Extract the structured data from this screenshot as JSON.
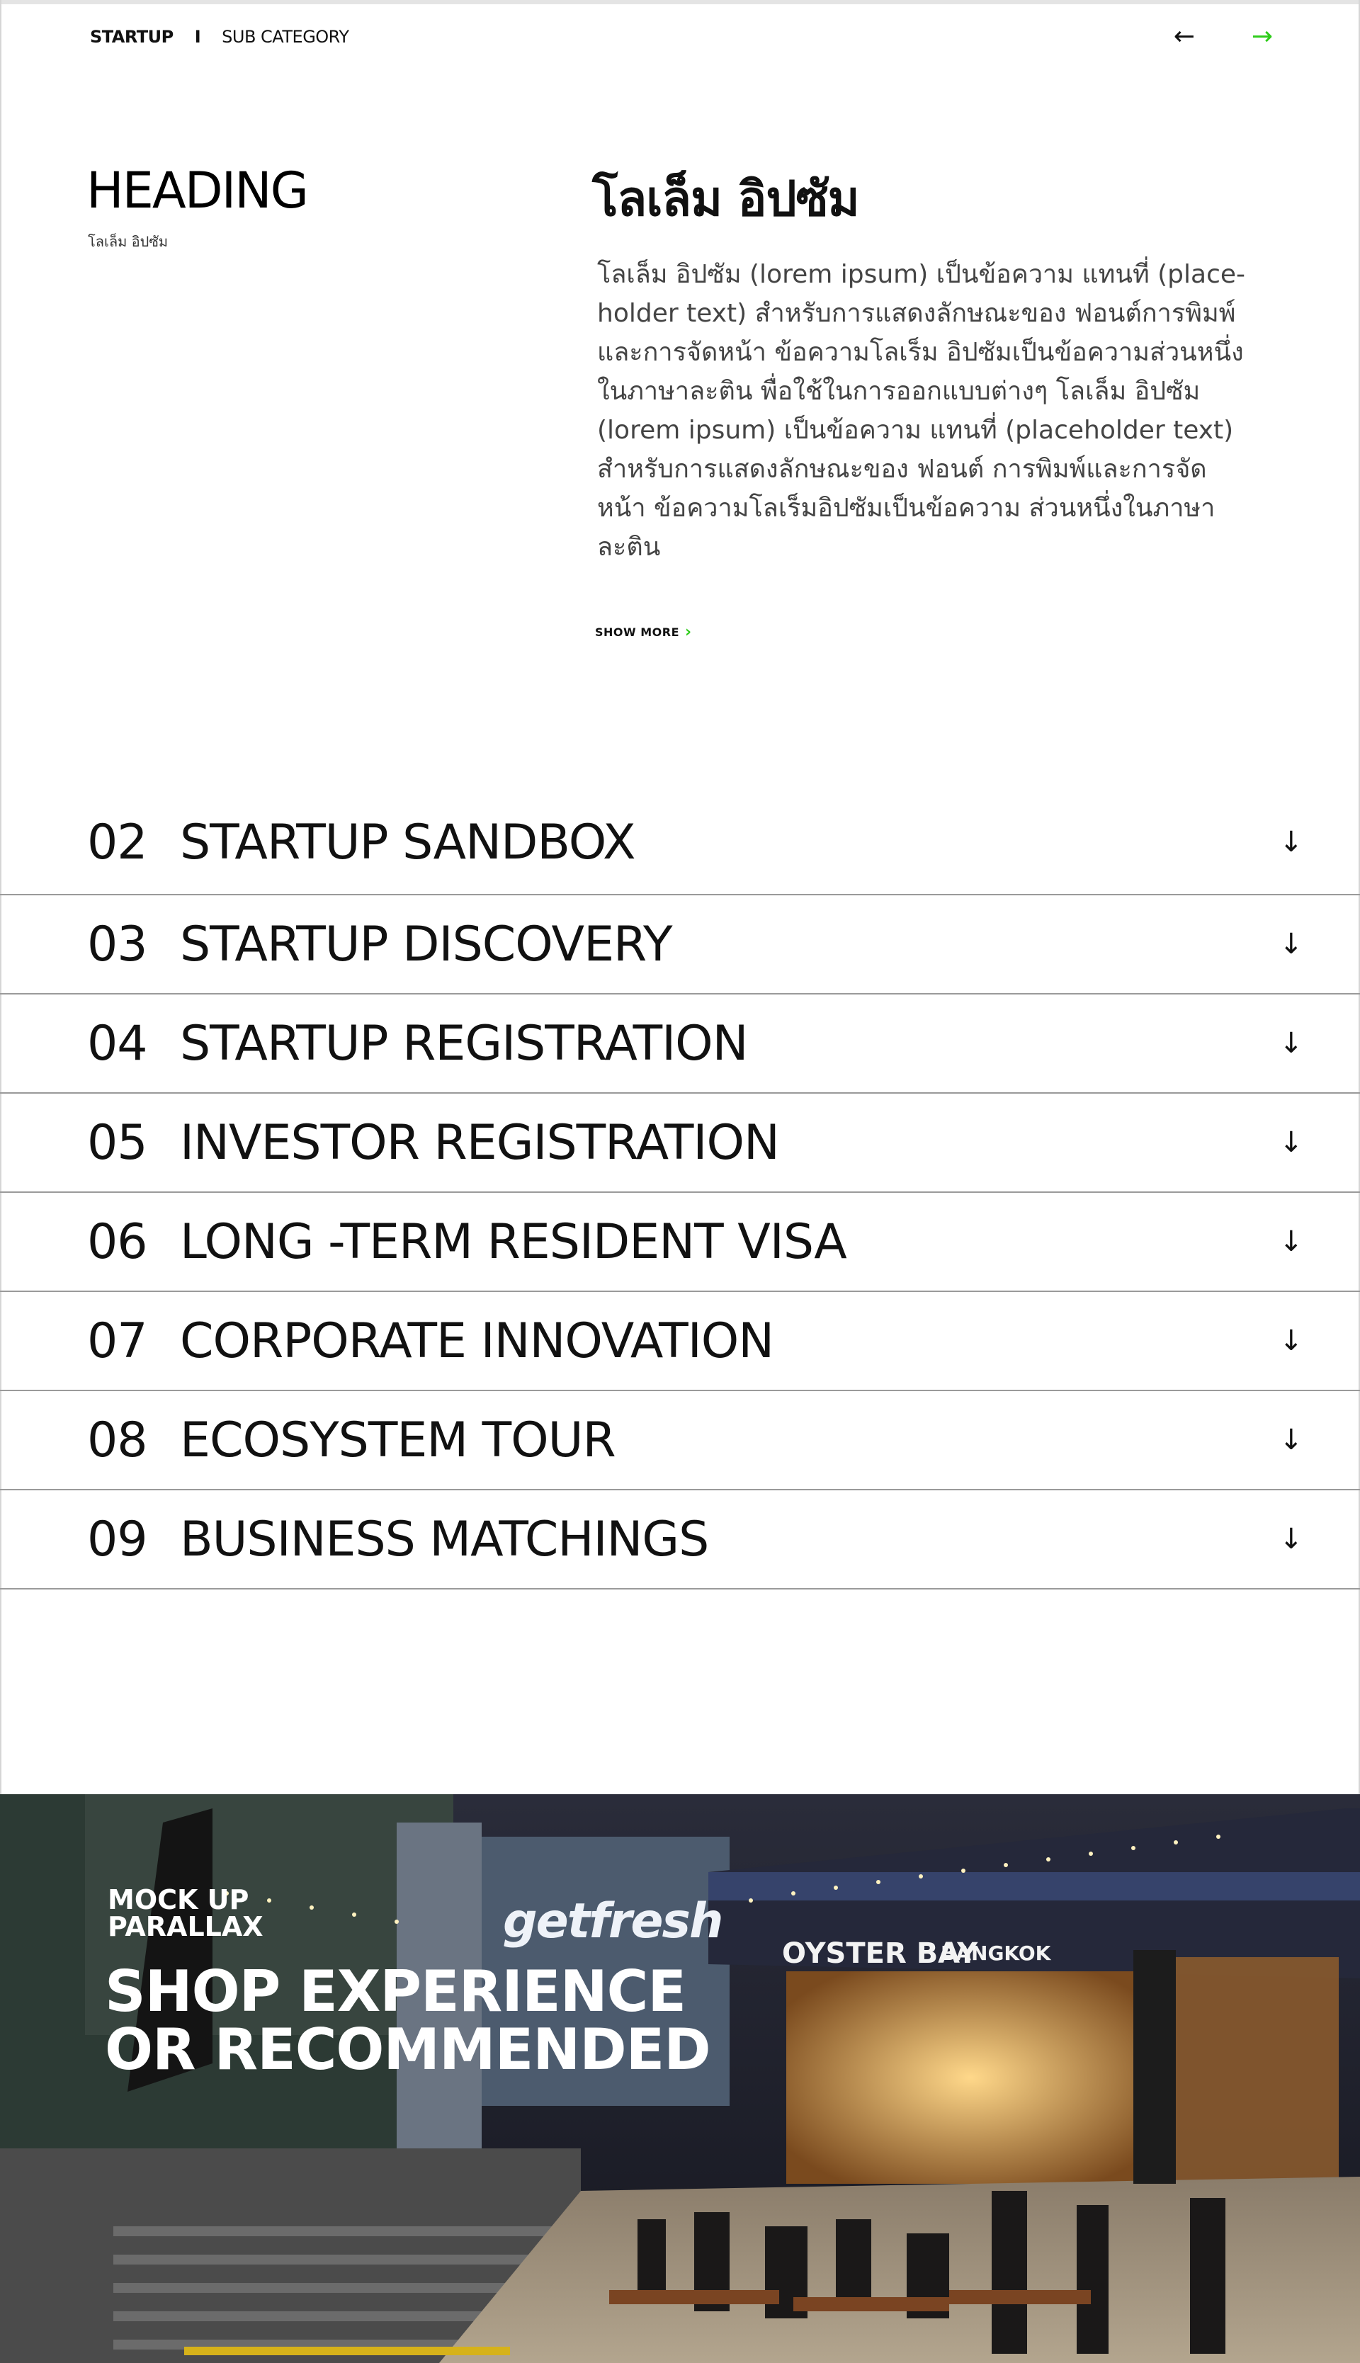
{
  "breadcrumb": {
    "main": "STARTUP",
    "separator": "I",
    "sub": "SUB CATEGORY"
  },
  "nav": {
    "prev_icon": "arrow-left-icon",
    "prev_glyph": "←",
    "next_icon": "arrow-right-icon",
    "next_glyph": "→",
    "accent_color": "#2ecc1a"
  },
  "intro": {
    "heading": "HEADING",
    "heading_sub": "โลเล็ม อิปซัม",
    "title": "โลเล็ม อิปซัม",
    "body_lines": [
      "โลเล็ม อิปซัม (lorem ipsum) เป็นข้อความ แทนที่ (place-",
      "holder text) สำหรับการแสดงลักษณะของ ฟอนต์การพิมพ์",
      "และการจัดหน้า ข้อความโลเร็ม อิปซัมเป็นข้อความส่วนหนึ่ง",
      "ในภาษาละติน  พื่อใช้ในการออกแบบต่างๆ โลเล็ม อิปซัม",
      "(lorem ipsum) เป็นข้อความ แทนที่ (placeholder text)",
      "สำหรับการแสดงลักษณะของ ฟอนต์ การพิมพ์และการจัด",
      "หน้า ข้อความโลเร็มอิปซัมเป็นข้อความ ส่วนหนึ่งในภาษา",
      "ละติน"
    ],
    "show_more": "SHOW MORE",
    "show_more_icon": "chevron-right-icon",
    "show_more_glyph": "›"
  },
  "accordion": {
    "arrow_icon": "arrow-down-icon",
    "arrow_glyph": "↓",
    "items": [
      {
        "num": "02",
        "title": "STARTUP SANDBOX"
      },
      {
        "num": "03",
        "title": "STARTUP DISCOVERY"
      },
      {
        "num": "04",
        "title": "STARTUP REGISTRATION"
      },
      {
        "num": "05",
        "title": "INVESTOR REGISTRATION"
      },
      {
        "num": "06",
        "title": "LONG -TERM RESIDENT VISA"
      },
      {
        "num": "07",
        "title": "CORPORATE INNOVATION"
      },
      {
        "num": "08",
        "title": "ECOSYSTEM  TOUR"
      },
      {
        "num": "09",
        "title": "BUSINESS  MATCHINGS"
      }
    ]
  },
  "hero": {
    "kicker_line1": "MOCK UP",
    "kicker_line2": "PARALLAX",
    "title_line1": "SHOP EXPERIENCE",
    "title_line2": "OR RECOMMENDED",
    "sign_getfresh": "getfresh",
    "sign_oyster": "OYSTER BAY",
    "sign_bangkok": "BANGKOK"
  }
}
